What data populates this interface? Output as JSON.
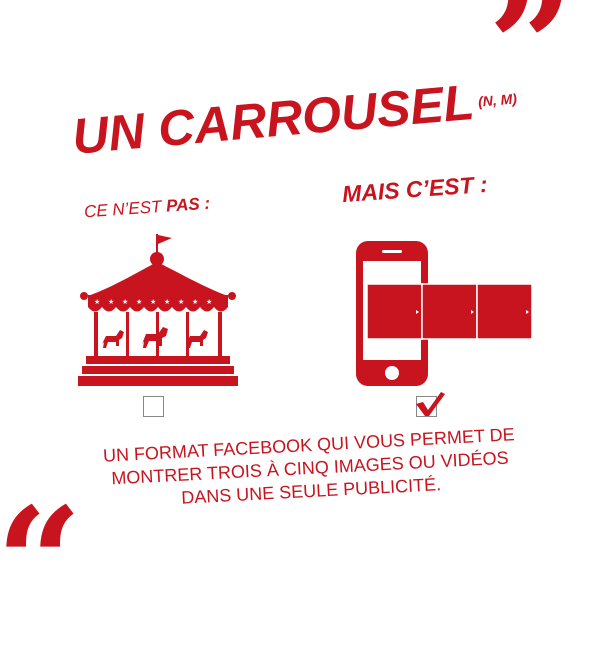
{
  "title": {
    "main": "UN CARROUSEL",
    "superscript": "(N, M)"
  },
  "left_label": {
    "prefix": "CE N’EST ",
    "emphasis": "PAS :"
  },
  "right_label": "MAIS C’EST :",
  "description": {
    "line1": "UN FORMAT FACEBOOK QUI VOUS PERMET DE",
    "line2": "MONTRER TROIS À CINQ IMAGES OU VIDÉOS",
    "line3": "DANS UNE SEULE PUBLICITÉ."
  },
  "quotes": {
    "top": "”",
    "bottom": "“"
  },
  "checkboxes": {
    "left_checked": false,
    "right_checked": true
  },
  "icons": {
    "left": "carousel-ride-icon",
    "right": "smartphone-carousel-icon",
    "check": "checkmark-icon"
  },
  "colors": {
    "accent": "#c8141e",
    "background": "#ffffff"
  }
}
